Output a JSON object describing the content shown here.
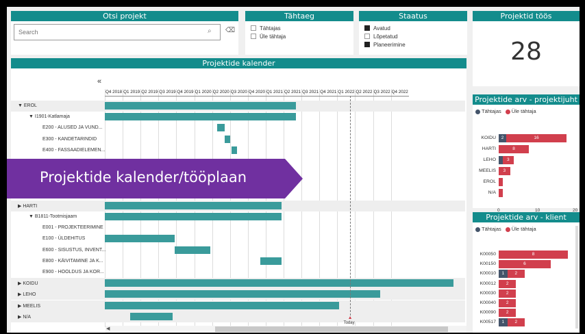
{
  "search_panel": {
    "title": "Otsi projekt",
    "placeholder": "Search"
  },
  "deadline_panel": {
    "title": "Tähtaeg",
    "options": [
      {
        "label": "Tähtajas",
        "checked": false
      },
      {
        "label": "Üle tähtaja",
        "checked": false
      }
    ]
  },
  "status_panel": {
    "title": "Staatus",
    "options": [
      {
        "label": "Avatud",
        "checked": true
      },
      {
        "label": "Lõpetatud",
        "checked": false
      },
      {
        "label": "Planeerimine",
        "checked": true
      }
    ]
  },
  "kpi": {
    "title": "Projektid töös",
    "value": "28"
  },
  "calendar": {
    "title": "Projektide kalender",
    "collapse": "«",
    "quarters": [
      "Q4 2018",
      "Q1 2019",
      "Q2 2019",
      "Q3 2019",
      "Q4 2019",
      "Q1 2020",
      "Q2 2020",
      "Q3 2020",
      "Q4 2020",
      "Q1 2021",
      "Q2 2021",
      "Q3 2021",
      "Q4 2021",
      "Q1 2022",
      "Q2 2022",
      "Q3 2022",
      "Q4 2022"
    ],
    "today_label": "Today",
    "rows": [
      {
        "label": "EROL",
        "level": 0,
        "icon": "▼",
        "bars": [
          [
            0,
            10.7
          ]
        ]
      },
      {
        "label": "I1901-Katlamaja",
        "level": 1,
        "icon": "▼",
        "bars": [
          [
            0,
            10.7
          ]
        ]
      },
      {
        "label": "E200 - ALUSED JA VUND...",
        "level": 2,
        "icon": "",
        "bars": [
          [
            6.3,
            6.7
          ]
        ]
      },
      {
        "label": "E300 - KANDETARINDID",
        "level": 2,
        "icon": "",
        "bars": [
          [
            6.7,
            7.0
          ]
        ]
      },
      {
        "label": "E400 - FASSAADIELEMEN...",
        "level": 2,
        "icon": "",
        "bars": [
          [
            7.1,
            7.4
          ]
        ]
      },
      {
        "label": "",
        "level": 2,
        "icon": "",
        "bars": []
      },
      {
        "label": "",
        "level": 2,
        "icon": "",
        "bars": []
      },
      {
        "label": "",
        "level": 2,
        "icon": "",
        "bars": []
      },
      {
        "label": "",
        "level": 2,
        "icon": "",
        "bars": []
      },
      {
        "label": "HARTI",
        "level": 0,
        "icon": "▶",
        "bars": [
          [
            0,
            9.9
          ]
        ]
      },
      {
        "label": "B1811-Tootmisjaam",
        "level": 1,
        "icon": "▼",
        "bars": [
          [
            0,
            9.9
          ]
        ]
      },
      {
        "label": "E001 - PROJEKTEERIMINE",
        "level": 2,
        "icon": "",
        "bars": []
      },
      {
        "label": "E100 - ÜLDEHITUS",
        "level": 2,
        "icon": "",
        "bars": [
          [
            0,
            3.9
          ]
        ]
      },
      {
        "label": "E600 - SISUSTUS, INVENT...",
        "level": 2,
        "icon": "",
        "bars": [
          [
            3.9,
            5.9
          ]
        ]
      },
      {
        "label": "E800 - KÄIVITAMINE JA K...",
        "level": 2,
        "icon": "",
        "bars": [
          [
            8.7,
            9.9
          ]
        ]
      },
      {
        "label": "E900 - HOOLDUS JA KOR...",
        "level": 2,
        "icon": "",
        "bars": []
      },
      {
        "label": "KOIDU",
        "level": 0,
        "icon": "▶",
        "bars": [
          [
            0,
            19.5
          ]
        ]
      },
      {
        "label": "LEHO",
        "level": 0,
        "icon": "▶",
        "bars": [
          [
            0,
            15.4
          ]
        ]
      },
      {
        "label": "MEELIS",
        "level": 0,
        "icon": "▶",
        "bars": [
          [
            0,
            13.1
          ]
        ]
      },
      {
        "label": "N/A",
        "level": 0,
        "icon": "▶",
        "bars": [
          [
            1.4,
            3.8
          ]
        ]
      }
    ]
  },
  "banner": {
    "text": "Projektide kalender/tööplaan",
    "color": "#7030a0"
  },
  "chart_data": [
    {
      "type": "bar",
      "title": "Projektide arv - projektijuht",
      "categories": [
        "KOIDU",
        "HARTI",
        "LEHO",
        "MEELIS",
        "EROL",
        "N/A"
      ],
      "series": [
        {
          "name": "Tähtajas",
          "color": "#44546a",
          "values": [
            2,
            0,
            1,
            0,
            0,
            0
          ]
        },
        {
          "name": "Üle tähtaja",
          "color": "#d13f4d",
          "values": [
            16,
            8,
            3,
            3,
            1,
            1
          ]
        }
      ],
      "value_labels": [
        [
          "2",
          "16"
        ],
        [
          "",
          "8"
        ],
        [
          "",
          "3"
        ],
        [
          "",
          "3"
        ],
        [
          "",
          ""
        ],
        [
          "",
          ""
        ]
      ],
      "xticks": [
        "0",
        "10",
        "20"
      ],
      "xlim": [
        0,
        20
      ]
    },
    {
      "type": "bar",
      "title": "Projektide arv - klient",
      "categories": [
        "K00050",
        "K00150",
        "K00010",
        "K00012",
        "K00030",
        "K00040",
        "K00090",
        "K00517"
      ],
      "series": [
        {
          "name": "Tähtajas",
          "color": "#44546a",
          "values": [
            0,
            0,
            1,
            0,
            0,
            0,
            0,
            1
          ]
        },
        {
          "name": "Üle tähtaja",
          "color": "#d13f4d",
          "values": [
            8,
            6,
            2,
            2,
            2,
            2,
            2,
            2
          ]
        }
      ],
      "value_labels": [
        [
          "",
          "8"
        ],
        [
          "",
          "6"
        ],
        [
          "1",
          "2"
        ],
        [
          "",
          "2"
        ],
        [
          "",
          "2"
        ],
        [
          "",
          "2"
        ],
        [
          "",
          "2"
        ],
        [
          "1",
          "2"
        ]
      ],
      "xticks": [
        "0",
        "5"
      ],
      "xlim": [
        0,
        8.7
      ]
    }
  ]
}
